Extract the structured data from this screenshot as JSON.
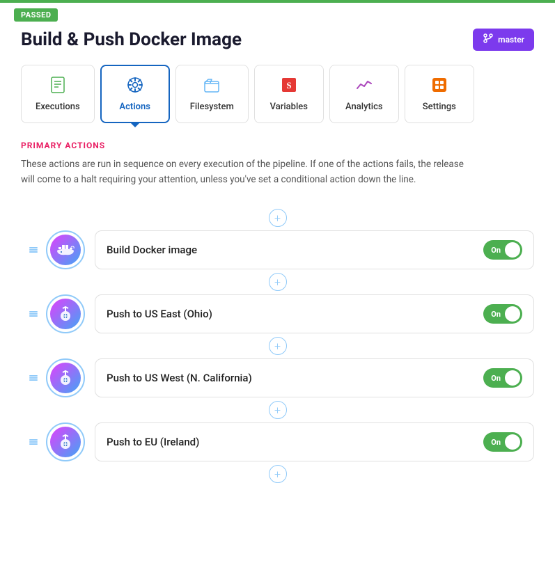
{
  "topBar": {
    "passedLabel": "PASSED"
  },
  "header": {
    "title": "Build & Push Docker Image",
    "branchIcon": "⎇",
    "branchLabel": "master"
  },
  "tabs": [
    {
      "id": "executions",
      "label": "Executions",
      "icon": "📄",
      "active": false
    },
    {
      "id": "actions",
      "label": "Actions",
      "icon": "⚙️",
      "active": true
    },
    {
      "id": "filesystem",
      "label": "Filesystem",
      "icon": "📁",
      "active": false
    },
    {
      "id": "variables",
      "label": "Variables",
      "icon": "💲",
      "active": false
    },
    {
      "id": "analytics",
      "label": "Analytics",
      "icon": "📈",
      "active": false
    },
    {
      "id": "settings",
      "label": "Settings",
      "icon": "🔥",
      "active": false
    }
  ],
  "primaryActionsSection": {
    "label": "PRIMARY ACTIONS",
    "description": "These actions are run in sequence on every execution of the pipeline. If one of the actions fails, the release will come to a halt requiring your attention, unless you've set a conditional action down the line."
  },
  "actions": [
    {
      "id": 1,
      "name": "Build Docker image",
      "enabled": true,
      "toggleLabel": "On"
    },
    {
      "id": 2,
      "name": "Push to US East (Ohio)",
      "enabled": true,
      "toggleLabel": "On"
    },
    {
      "id": 3,
      "name": "Push to US West (N. California)",
      "enabled": true,
      "toggleLabel": "On"
    },
    {
      "id": 4,
      "name": "Push to EU (Ireland)",
      "enabled": true,
      "toggleLabel": "On"
    }
  ]
}
